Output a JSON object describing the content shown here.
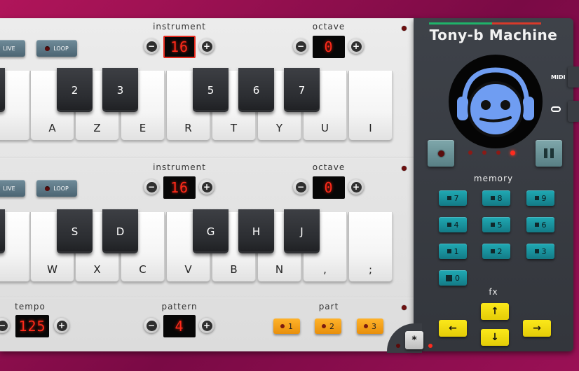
{
  "rows": [
    {
      "instrument_label": "instrument",
      "instrument_value": "16",
      "octave_label": "octave",
      "octave_value": "0",
      "live_label": "LIVE",
      "loop_label": "LOOP",
      "black_keys": [
        "2",
        "3",
        "5",
        "6",
        "7"
      ],
      "white_keys": [
        "A",
        "Z",
        "E",
        "R",
        "T",
        "Y",
        "U",
        "I"
      ]
    },
    {
      "instrument_label": "instrument",
      "instrument_value": "16",
      "octave_label": "octave",
      "octave_value": "0",
      "live_label": "LIVE",
      "loop_label": "LOOP",
      "black_keys": [
        "S",
        "D",
        "G",
        "H",
        "J"
      ],
      "white_keys": [
        "W",
        "X",
        "C",
        "V",
        "B",
        "N",
        ",",
        ";"
      ]
    }
  ],
  "bottom": {
    "tempo_label": "tempo",
    "tempo_value": "125",
    "pattern_label": "pattern",
    "pattern_value": "4",
    "part_label": "part",
    "parts": [
      "1",
      "2",
      "3"
    ],
    "asterisk_label": "*"
  },
  "controls": {
    "minus": "−",
    "plus": "+"
  },
  "machine": {
    "title": "Tony-b Machine",
    "midi_label": "MIDI",
    "memory_label": "memory",
    "memory_keys": [
      [
        "7",
        "8",
        "9"
      ],
      [
        "4",
        "5",
        "6"
      ],
      [
        "1",
        "2",
        "3"
      ]
    ],
    "zero_key": "0",
    "fx_label": "fx",
    "fx_arrows": {
      "up": "↑",
      "down": "↓",
      "left": "←",
      "right": "→"
    },
    "pause_icon": "pause-icon",
    "record_icon": "record-icon",
    "gamepad_icon": "gamepad-icon"
  },
  "colors": {
    "background": "#b0155a",
    "lcd_digits": "#ff2a1a",
    "memory_buttons": "#1b9aa5",
    "fx_buttons": "#f4dc0f",
    "part_buttons": "#f6a11a",
    "mascot": "#6f9df2"
  }
}
